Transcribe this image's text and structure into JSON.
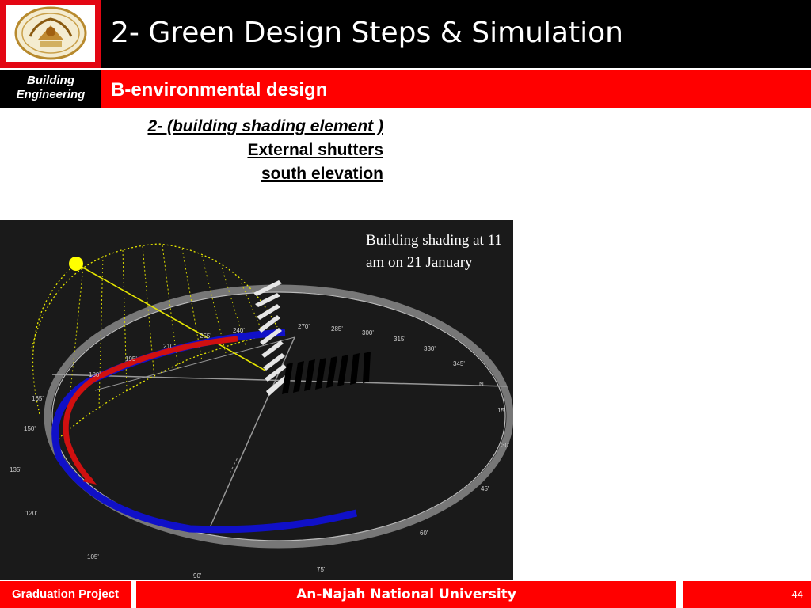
{
  "header": {
    "title": "2- Green Design Steps & Simulation",
    "logo_icon": "university-seal-icon"
  },
  "subheader": {
    "department": "Building Engineering",
    "section": "B-environmental design"
  },
  "content": {
    "line1": "2- (building shading element )",
    "line2": "External shutters",
    "line3": "south elevation"
  },
  "simulation": {
    "caption": "Building shading at 11 am on 21 January",
    "degree_labels": [
      "90'",
      "105'",
      "120'",
      "135'",
      "150'",
      "165'",
      "180'",
      "195'",
      "210'",
      "240'",
      "255'",
      "270'",
      "285'",
      "300'",
      "315'",
      "330'",
      "345'",
      "N",
      "15'",
      "30'",
      "45'",
      "60'",
      "75'"
    ]
  },
  "footer": {
    "left": "Graduation Project",
    "center": "An-Najah National University",
    "page": "44"
  },
  "colors": {
    "brand_red": "#ff0000",
    "header_black": "#000000",
    "sun_yellow": "#ffff00",
    "winter_path_blue": "#1010c8",
    "summer_path_red": "#d01010"
  }
}
